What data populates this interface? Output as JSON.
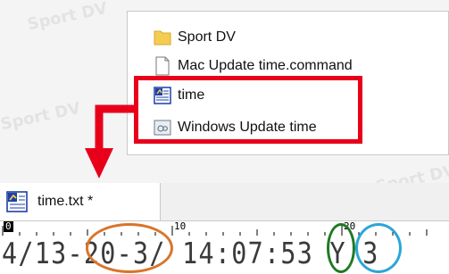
{
  "explorer": {
    "items": [
      {
        "label": "Sport DV",
        "icon": "folder-icon"
      },
      {
        "label": "Mac Update time.command",
        "icon": "document-icon"
      },
      {
        "label": "time",
        "icon": "text-file-icon"
      },
      {
        "label": "Windows Update time",
        "icon": "shortcut-icon"
      }
    ]
  },
  "editor": {
    "tab_title": "time.txt *",
    "ruler_labels": [
      "0",
      "10",
      "20"
    ],
    "line_text": "4/13-20-3/ 14:07:53 Y 3"
  },
  "annotations": {
    "highlight_color": "#e8001b",
    "oval_colors": {
      "date": "#d9742a",
      "year": "#1f7a24",
      "value": "#2aa6d9"
    }
  },
  "watermark": "Sport DV"
}
